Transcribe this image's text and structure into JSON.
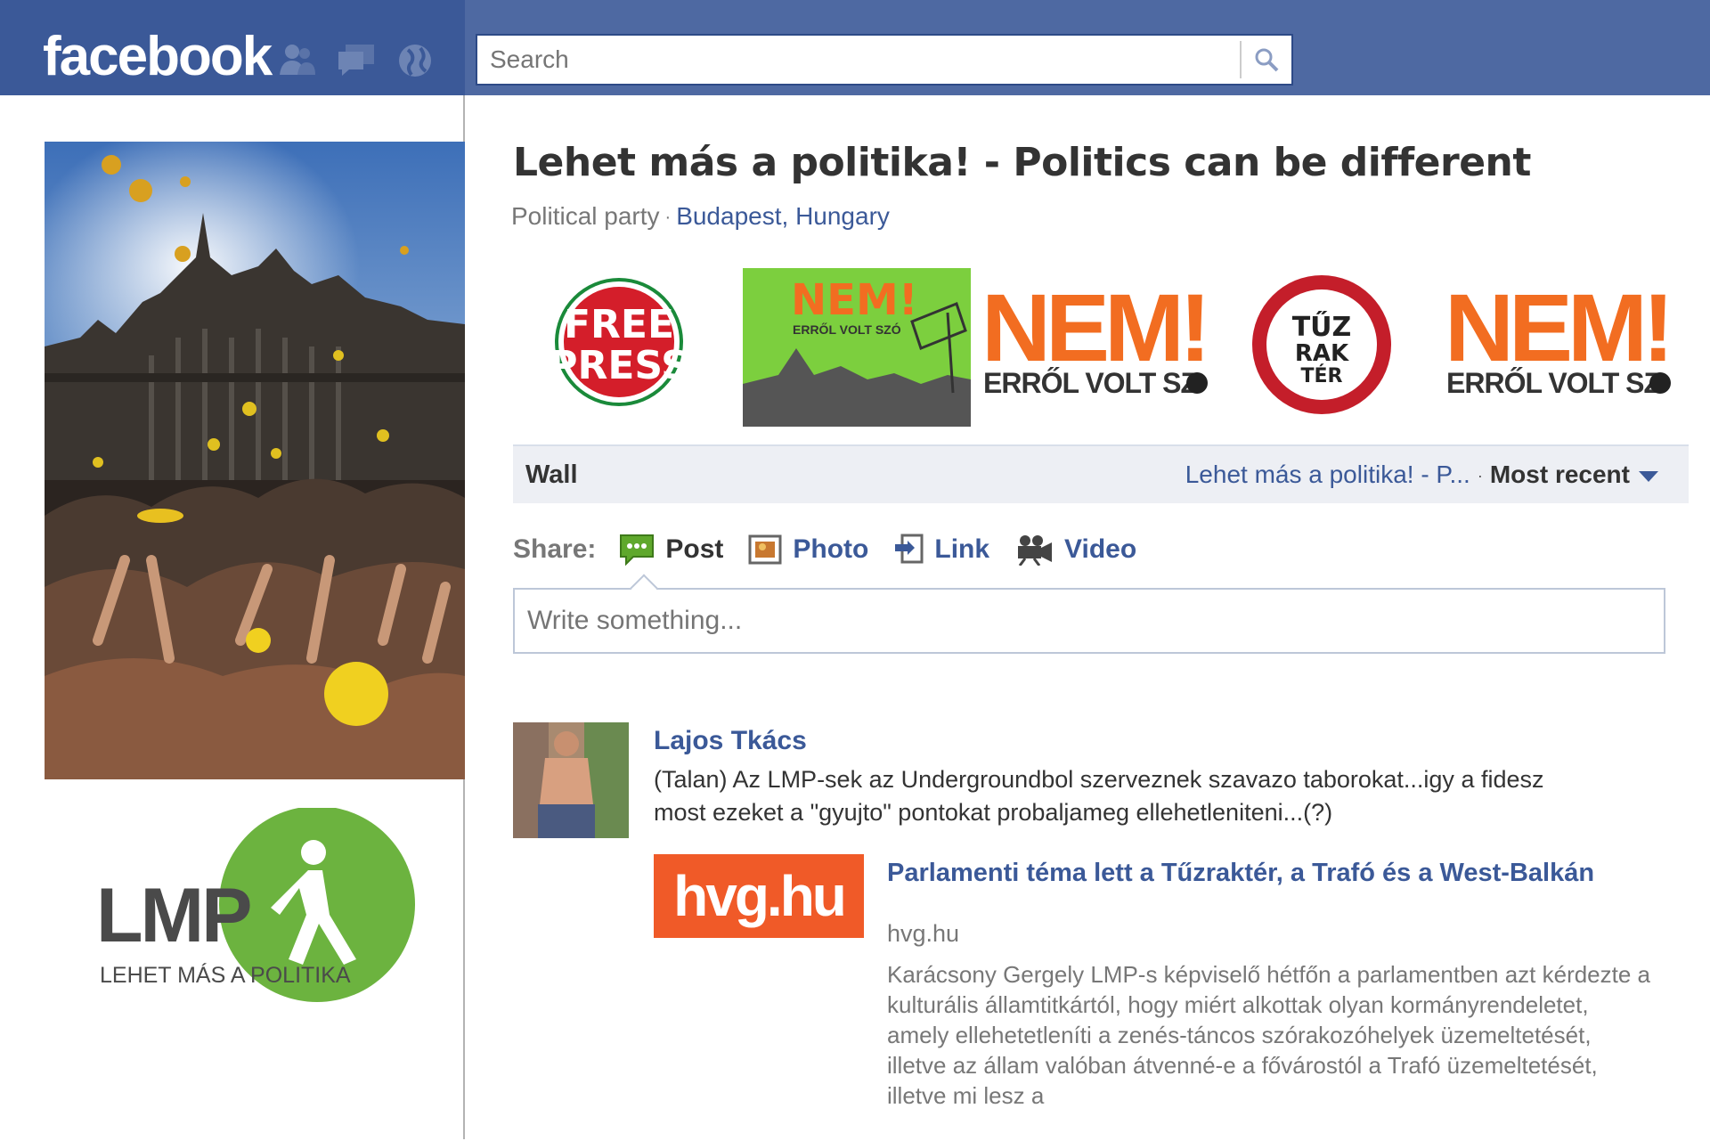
{
  "header": {
    "logo": "facebook",
    "search_placeholder": "Search"
  },
  "page": {
    "title": "Lehet más a politika! - Politics can be different",
    "category": "Political party",
    "location": "Budapest, Hungary"
  },
  "badges": {
    "free_press": [
      "FREE",
      "PRESS"
    ],
    "nem_small": [
      "NEM!",
      "ERRŐL VOLT SZÓ"
    ],
    "nem_large_1": [
      "NEM!",
      "ERRŐL VOLT SZ"
    ],
    "tuzrakter": [
      "TŰZ",
      "RAK",
      "TÉR"
    ],
    "nem_large_2": [
      "NEM!",
      "ERRŐL VOLT SZ"
    ]
  },
  "lmp_logo": {
    "letters": "LMP",
    "tagline": "LEHET MÁS A POLITIKA"
  },
  "wall": {
    "label": "Wall",
    "filter_page": "Lehet más a politika! - P...",
    "filter_sort": "Most recent"
  },
  "share": {
    "label": "Share:",
    "items": [
      {
        "label": "Post",
        "icon": "speech-bubble-icon"
      },
      {
        "label": "Photo",
        "icon": "photo-icon"
      },
      {
        "label": "Link",
        "icon": "link-icon"
      },
      {
        "label": "Video",
        "icon": "video-camera-icon"
      }
    ],
    "composer_placeholder": "Write something..."
  },
  "story": {
    "author": "Lajos Tkács",
    "text": "(Talan) Az LMP-sek az Undergroundbol szerveznek szavazo taborokat...igy a fidesz most ezeket a \"gyujto\" pontokat probaljameg ellehetleniteni...(?)",
    "attachment": {
      "thumb_text": "hvg.hu",
      "title": "Parlamenti téma lett a Tűzraktér, a Trafó és a West-Balkán",
      "domain": "hvg.hu",
      "description": "Karácsony Gergely LMP-s képviselő hétfőn a parlamentben azt kérdezte a kulturális államtitkártól, hogy miért alkottak olyan kormányrendeletet, amely ellehetetleníti a zenés-táncos szórakozóhelyek üzemeltetését, illetve az állam valóban átvenné-e a fővárostól a Trafó üzemeltetését, illetve mi lesz a"
    }
  },
  "colors": {
    "brand_blue": "#3b5998",
    "lmp_green": "#6cb33f",
    "nem_orange": "#f26d21",
    "hvg_orange": "#f05a28"
  }
}
